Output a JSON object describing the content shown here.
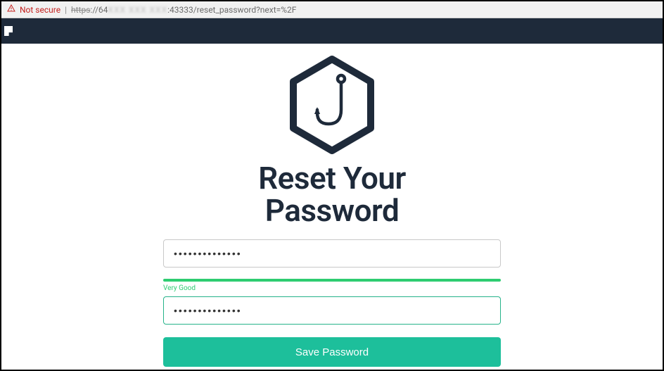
{
  "addressBar": {
    "notSecure": "Not secure",
    "urlPrefix": "https",
    "urlSep": "://",
    "urlHost": "64",
    "urlBlurred": "XXX XXX XXX",
    "urlPort": ":43333",
    "urlPath": "/reset_password?next=%2F"
  },
  "page": {
    "titleLine1": "Reset Your",
    "titleLine2": "Password"
  },
  "form": {
    "password1Value": "••••••••••••••",
    "password2Value": "••••••••••••••",
    "strengthLabel": "Very Good",
    "saveLabel": "Save Password"
  },
  "colors": {
    "navBg": "#1e2a3a",
    "accent": "#1dbf9b",
    "strength": "#2ecc71",
    "warning": "#c5221f"
  }
}
